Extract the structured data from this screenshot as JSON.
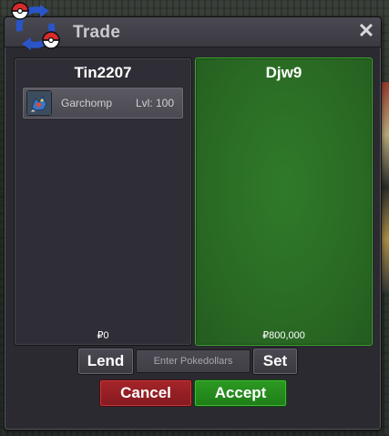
{
  "window": {
    "title": "Trade",
    "close_glyph": "✕"
  },
  "left_panel": {
    "player_name": "Tin2207",
    "items": [
      {
        "icon": "garchomp-icon",
        "name": "Garchomp",
        "level": "Lvl: 100"
      }
    ],
    "pokedollars": "₽0"
  },
  "right_panel": {
    "player_name": "Djw9",
    "pokedollars": "₽800,000"
  },
  "controls": {
    "lend_label": "Lend",
    "pokedollar_placeholder": "Enter Pokedollars",
    "set_label": "Set",
    "cancel_label": "Cancel",
    "accept_label": "Accept"
  },
  "colors": {
    "accept_panel": "#2a6a24",
    "cancel": "#a5252a",
    "accept": "#2c9a22"
  }
}
